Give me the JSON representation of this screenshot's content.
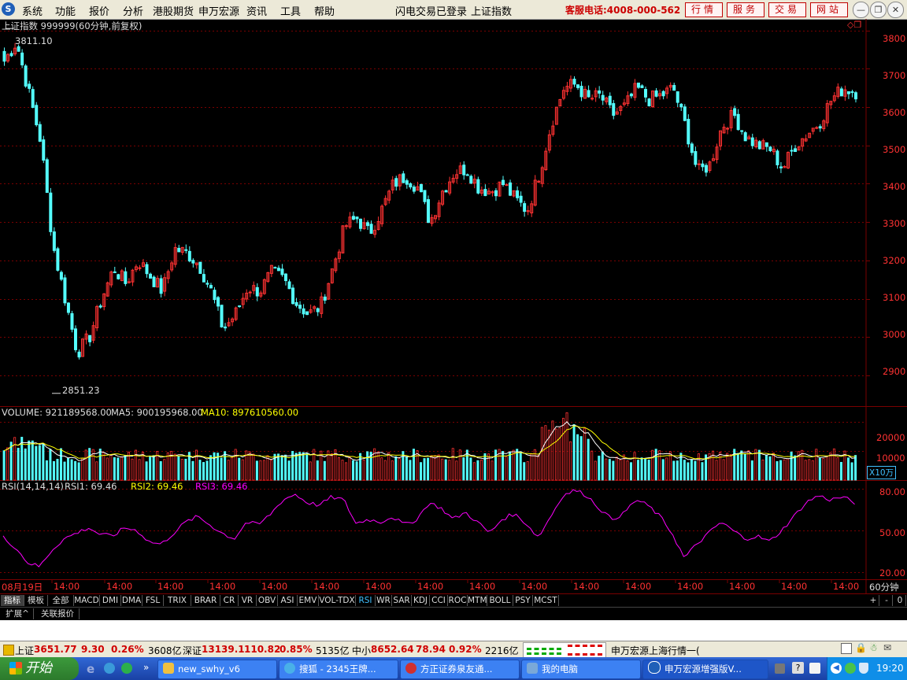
{
  "menubar": {
    "items": [
      "系统",
      "功能",
      "报价",
      "分析",
      "港股期货",
      "申万宏源",
      "资讯",
      "工具",
      "帮助"
    ],
    "login_status": "闪电交易已登录",
    "current_index": "上证指数",
    "hotline": "客服电话:4008-000-562",
    "buttons": [
      "行情",
      "服务",
      "交易",
      "网站"
    ]
  },
  "chart_header": {
    "title": "上证指数 999999(60分钟,前复权)",
    "max_label": "3811.10",
    "min_label": "2851.23"
  },
  "price_axis": {
    "ticks": [
      "3800",
      "3700",
      "3600",
      "3500",
      "3400",
      "3300",
      "3200",
      "3100",
      "3000",
      "2900"
    ]
  },
  "volume": {
    "label": "VOLUME: 921189568.00",
    "ma5": "MA5: 900195968.00",
    "ma10": "MA10: 897610560.00",
    "ticks": [
      "20000",
      "10000"
    ],
    "unit": "X10万"
  },
  "rsi": {
    "label": "RSI(14,14,14)",
    "rsi1": "RSI1: 69.46",
    "rsi2": "RSI2: 69.46",
    "rsi3": "RSI3: 69.46",
    "ticks": [
      "80.00",
      "50.00",
      "20.00"
    ]
  },
  "time_axis": {
    "labels": [
      "08月19日",
      "14:00",
      "14:00",
      "14:00",
      "14:00",
      "14:00",
      "14:00",
      "14:00",
      "14:00",
      "14:00",
      "14:00",
      "14:00",
      "14:00",
      "14:00",
      "14:00",
      "14:00",
      "14:00"
    ],
    "period": "60分钟"
  },
  "colors": {
    "up": "#ff3232",
    "down": "#54ffff",
    "grid": "#7a0000",
    "ma5": "#ffffff",
    "ma10": "#ffff00",
    "rsi": "#ff00ff"
  },
  "indicator_tabs": [
    "指标",
    "模板",
    "全部",
    "MACD",
    "DMI",
    "DMA",
    "FSL",
    "TRIX",
    "BRAR",
    "CR",
    "VR",
    "OBV",
    "ASI",
    "EMV",
    "VOL-TDX",
    "RSI",
    "WR",
    "SAR",
    "KDJ",
    "CCI",
    "ROC",
    "MTM",
    "BOLL",
    "PSY",
    "MCST"
  ],
  "active_tab": "RSI",
  "tab_controls": [
    "+",
    "-",
    "0"
  ],
  "extra_tabs": [
    "扩展^",
    "关联报价"
  ],
  "statusbar": {
    "sh_label": "上证",
    "sh_value": "3651.77",
    "sh_change": "9.30",
    "sh_pct": "0.26%",
    "sh_amount": "3608亿",
    "sz_label": "深证",
    "sz_value": "13139.1",
    "sz_change": "110.82",
    "sz_pct": "0.85%",
    "sz_amount": "5135亿",
    "zx_label": "中小",
    "zx_value": "8652.64",
    "zx_change": "78.94",
    "zx_pct": "0.92%",
    "zx_amount": "2216亿",
    "ticker": "申万宏源上海行情一("
  },
  "taskbar": {
    "start": "开始",
    "items": [
      "new_swhy_v6",
      "搜狐 - 2345王牌...",
      "方正证券泉友通...",
      "我的电脑",
      "申万宏源增强版V..."
    ],
    "clock": "19:20"
  },
  "chart_data": {
    "type": "candlestick",
    "title": "上证指数 999999(60分钟,前复权)",
    "ylim": [
      2820,
      3830
    ],
    "y_ticks": [
      2900,
      3000,
      3100,
      3200,
      3300,
      3400,
      3500,
      3600,
      3700,
      3800
    ],
    "max": 3811.1,
    "min": 2851.23,
    "close_path": [
      3720,
      3770,
      3640,
      3510,
      3240,
      3100,
      2960,
      3000,
      3100,
      3180,
      3140,
      3200,
      3160,
      3120,
      3230,
      3220,
      3190,
      3120,
      3020,
      3060,
      3130,
      3120,
      3170,
      3150,
      3090,
      3060,
      3080,
      3180,
      3290,
      3310,
      3270,
      3330,
      3400,
      3420,
      3390,
      3300,
      3380,
      3430,
      3440,
      3390,
      3380,
      3400,
      3360,
      3330,
      3430,
      3560,
      3650,
      3660,
      3620,
      3630,
      3580,
      3600,
      3650,
      3620,
      3630,
      3650,
      3550,
      3430,
      3450,
      3550,
      3580,
      3520,
      3500,
      3490,
      3440,
      3500,
      3530,
      3560,
      3620,
      3650,
      3640
    ],
    "volume_ylim": [
      0,
      25000
    ],
    "volume_unit": "X10万",
    "rsi_ylim": [
      15,
      85
    ],
    "rsi_path": [
      45,
      38,
      27,
      24,
      36,
      44,
      48,
      52,
      47,
      46,
      52,
      50,
      42,
      40,
      48,
      56,
      60,
      54,
      48,
      44,
      56,
      54,
      62,
      72,
      76,
      70,
      68,
      74,
      72,
      55,
      58,
      56,
      60,
      54,
      58,
      70,
      66,
      58,
      63,
      56,
      48,
      58,
      62,
      55,
      45,
      60,
      75,
      79,
      75,
      66,
      58,
      62,
      72,
      68,
      60,
      48,
      30,
      40,
      48,
      56,
      50,
      44,
      46,
      42,
      50,
      60,
      70,
      75,
      72,
      74,
      70
    ]
  }
}
